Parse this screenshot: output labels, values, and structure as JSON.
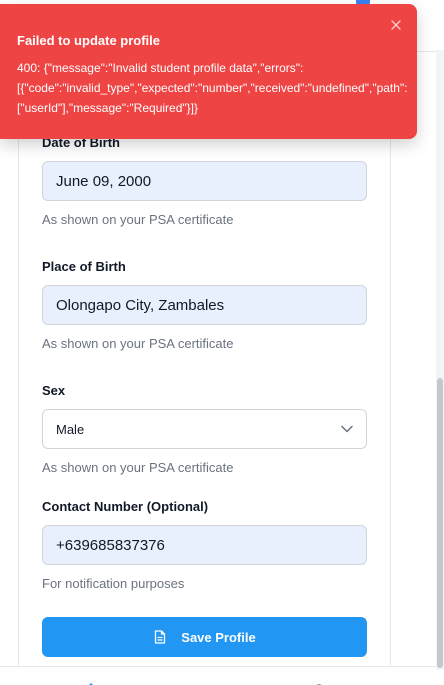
{
  "toast": {
    "title": "Failed to update profile",
    "message_line1": "400: {\"message\":\"Invalid student profile data\",\"errors\":",
    "message_line2": "[{\"code\":\"invalid_type\",\"expected\":\"number\",\"received\":\"undefined\",\"path\":",
    "message_line3": "[\"userId\"],\"message\":\"Required\"}]}",
    "close_icon": "close-icon",
    "color": "#ef4444"
  },
  "form": {
    "date_of_birth": {
      "label": "Date of Birth",
      "value": "June 09, 2000",
      "helper": "As shown on your PSA certificate"
    },
    "place_of_birth": {
      "label": "Place of Birth",
      "value": "Olongapo City, Zambales",
      "helper": "As shown on your PSA certificate"
    },
    "sex": {
      "label": "Sex",
      "selected": "Male",
      "helper": "As shown on your PSA certificate"
    },
    "contact_number": {
      "label": "Contact Number (Optional)",
      "value": "+639685837376",
      "helper": "For notification purposes"
    },
    "save_button": {
      "label": "Save Profile",
      "icon": "document-icon",
      "color": "#2196f3"
    }
  },
  "bottom_nav": {
    "items": [
      {
        "icon": "home-icon"
      },
      {
        "icon": "settings-icon"
      }
    ]
  }
}
